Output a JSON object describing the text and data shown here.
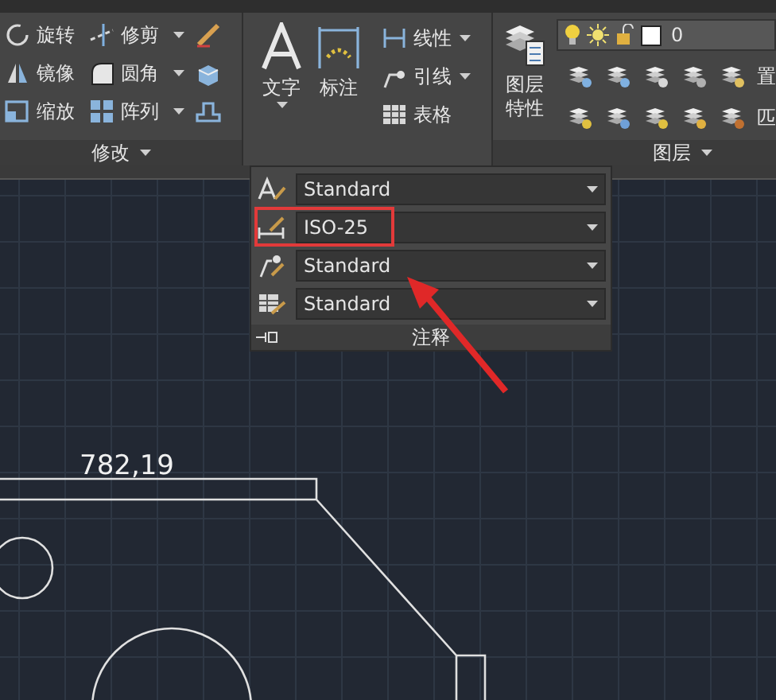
{
  "modify_panel": {
    "title": "修改",
    "tools": [
      {
        "label": "旋转",
        "kind": "rotate",
        "dropdown": false
      },
      {
        "label": "修剪",
        "kind": "trim",
        "dropdown": true
      },
      {
        "label": "镜像",
        "kind": "mirror",
        "dropdown": false
      },
      {
        "label": "圆角",
        "kind": "fillet",
        "dropdown": true
      },
      {
        "label": "缩放",
        "kind": "scale",
        "dropdown": false
      },
      {
        "label": "阵列",
        "kind": "array",
        "dropdown": true
      }
    ]
  },
  "annotation_panel": {
    "big_tools": [
      {
        "label": "文字",
        "kind": "text",
        "dropdown": true
      },
      {
        "label": "标注",
        "kind": "dimension",
        "dropdown": false
      }
    ],
    "tools": [
      {
        "label": "线性",
        "kind": "linear",
        "dropdown": true
      },
      {
        "label": "引线",
        "kind": "leader",
        "dropdown": true
      },
      {
        "label": "表格",
        "kind": "table",
        "dropdown": false
      }
    ]
  },
  "layers_panel": {
    "title": "图层",
    "big_tool": "图层特性",
    "current_layer": "0",
    "row_labels": [
      "置",
      "匹"
    ]
  },
  "annotation_dropdown": {
    "footer": "注释",
    "styles": [
      {
        "kind": "text",
        "value": "Standard",
        "marked": false
      },
      {
        "kind": "dimension",
        "value": "ISO-25",
        "marked": true
      },
      {
        "kind": "leader",
        "value": "Standard",
        "marked": false
      },
      {
        "kind": "table",
        "value": "Standard",
        "marked": false
      }
    ]
  },
  "canvas": {
    "dimension_label": "782,19"
  }
}
